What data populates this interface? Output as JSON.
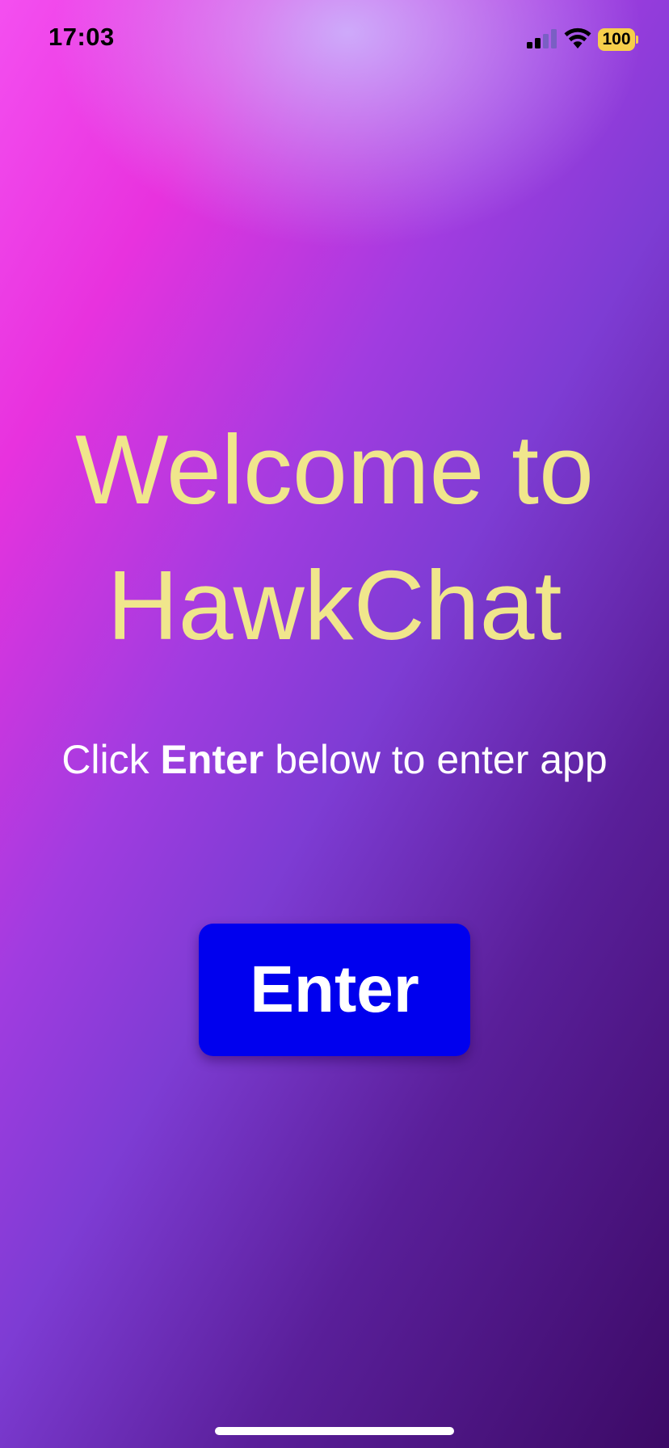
{
  "status_bar": {
    "time": "17:03",
    "battery_level": "100",
    "icons": [
      "cellular-signal-icon",
      "wifi-icon",
      "battery-icon"
    ],
    "signal_bars_active": 2,
    "signal_bars_total": 4
  },
  "welcome": {
    "line1": "Welcome to",
    "line2": "HawkChat"
  },
  "instruction": {
    "prefix": "Click ",
    "emphasis": "Enter",
    "suffix": " below to enter app"
  },
  "enter_button": {
    "label": "Enter"
  },
  "colors": {
    "title_text": "#f0e68c",
    "button_background": "#0000ee",
    "button_text": "#ffffff",
    "battery": "#f7cf4b",
    "gradient_start": "#f44ff0",
    "gradient_end": "#3c0a66"
  }
}
